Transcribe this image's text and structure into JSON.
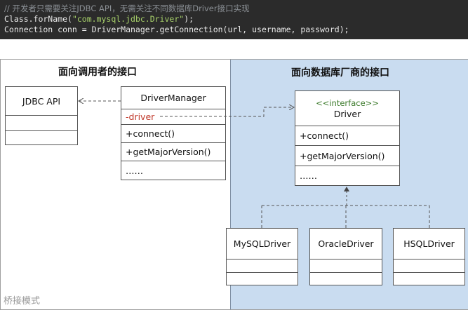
{
  "code": {
    "comment": "// 开发者只需要关注JDBC API，无需关注不同数据库Driver接口实现",
    "line2_prefix": "Class.forName(",
    "line2_string": "\"com.mysql.jdbc.Driver\"",
    "line2_suffix": ");",
    "line3": "Connection conn = DriverManager.getConnection(url, username, password);"
  },
  "sections": {
    "left_title": "面向调用者的接口",
    "right_title": "面向数据库厂商的接口"
  },
  "classes": {
    "jdbc_api": {
      "name": "JDBC API"
    },
    "driver_manager": {
      "name": "DriverManager",
      "field": "-driver",
      "methods": [
        "+connect()",
        "+getMajorVersion()"
      ],
      "more": "……"
    },
    "driver": {
      "stereotype": "<<interface>>",
      "name": "Driver",
      "methods": [
        "+connect()",
        "+getMajorVersion()"
      ],
      "more": "……"
    },
    "mysql_driver": {
      "name": "MySQLDriver"
    },
    "oracle_driver": {
      "name": "OracleDriver"
    },
    "hsql_driver": {
      "name": "HSQLDriver"
    }
  },
  "watermark": "桥接模式",
  "colors": {
    "right_panel_bg": "#c9dcf0",
    "field_red": "#c0392b",
    "stereotype_green": "#3b7a2a",
    "code_bg": "#2b2b2b"
  }
}
